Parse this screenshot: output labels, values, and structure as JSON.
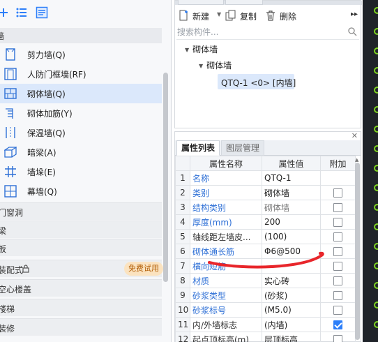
{
  "left_panel": {
    "category_header": "墙",
    "items": [
      {
        "label": "剪力墙(Q)",
        "icon": "shear-wall-icon"
      },
      {
        "label": "人防门框墙(RF)",
        "icon": "civil-defense-door-wall-icon"
      },
      {
        "label": "砌体墙(Q)",
        "icon": "masonry-wall-icon",
        "selected": true
      },
      {
        "label": "砌体加筋(Y)",
        "icon": "masonry-reinforcement-icon"
      },
      {
        "label": "保温墙(Q)",
        "icon": "insulation-wall-icon"
      },
      {
        "label": "暗梁(A)",
        "icon": "hidden-beam-icon"
      },
      {
        "label": "墙垛(E)",
        "icon": "wall-pier-icon"
      },
      {
        "label": "幕墙(Q)",
        "icon": "curtain-wall-icon"
      }
    ],
    "categories": [
      {
        "label": "门窗洞"
      },
      {
        "label": "梁"
      },
      {
        "label": "板"
      },
      {
        "label": "装配式",
        "badge": "免费试用",
        "locked": true
      },
      {
        "label": "空心楼盖"
      },
      {
        "label": "楼梯"
      },
      {
        "label": "装修"
      }
    ]
  },
  "component_panel": {
    "toolbar": {
      "new_label": "新建",
      "copy_label": "复制",
      "delete_label": "删除"
    },
    "search": {
      "placeholder": "搜索构件..."
    },
    "tree": {
      "root": "砌体墙",
      "child": "砌体墙",
      "item": "QTQ-1 <0> [内墙]"
    }
  },
  "properties_panel": {
    "tabs": [
      "属性列表",
      "图层管理"
    ],
    "columns": [
      "属性名称",
      "属性值",
      "附加"
    ],
    "rows": [
      {
        "idx": "1",
        "name": "名称",
        "value": "QTQ-1",
        "link": true,
        "checkbox": null
      },
      {
        "idx": "2",
        "name": "类别",
        "value": "砌体墙",
        "link": true,
        "checkbox": false
      },
      {
        "idx": "3",
        "name": "结构类别",
        "value": "砌体墙",
        "link": true,
        "muted": true,
        "checkbox": false
      },
      {
        "idx": "4",
        "name": "厚度(mm)",
        "value": "200",
        "link": true,
        "checkbox": false
      },
      {
        "idx": "5",
        "name": "轴线距左墙皮...",
        "value": "(100)",
        "link": false,
        "checkbox": false
      },
      {
        "idx": "6",
        "name": "砌体通长筋",
        "value": "Φ6@500",
        "link": true,
        "checkbox": false
      },
      {
        "idx": "7",
        "name": "横向短筋",
        "value": "",
        "link": true,
        "checkbox": false
      },
      {
        "idx": "8",
        "name": "材质",
        "value": "实心砖",
        "link": true,
        "checkbox": false
      },
      {
        "idx": "9",
        "name": "砂浆类型",
        "value": "(砂浆)",
        "link": true,
        "checkbox": false
      },
      {
        "idx": "10",
        "name": "砂浆标号",
        "value": "(M5.0)",
        "link": true,
        "checkbox": false
      },
      {
        "idx": "11",
        "name": "内/外墙标志",
        "value": "(内墙)",
        "link": false,
        "checkbox": true
      },
      {
        "idx": "12",
        "name": "起点顶标高(m)",
        "value": "层顶标高",
        "link": false,
        "checkbox": false
      }
    ]
  },
  "colors": {
    "accent": "#2d7ff9",
    "selected_bg": "#dbe8fb",
    "annotation": "#e8262b",
    "link": "#2d6fd6"
  }
}
